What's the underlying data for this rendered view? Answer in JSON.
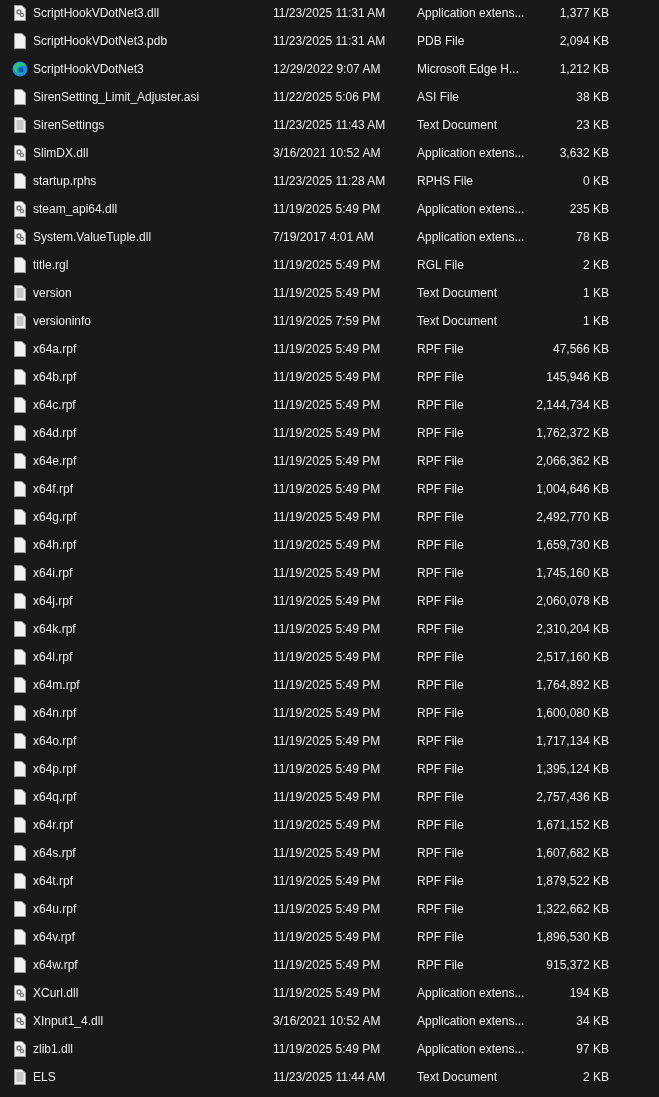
{
  "files": [
    {
      "kind": "dll",
      "name": "ScriptHookVDotNet3.dll",
      "date": "11/23/2025 11:31 AM",
      "type": "Application extens...",
      "size": "1,377 KB"
    },
    {
      "kind": "file",
      "name": "ScriptHookVDotNet3.pdb",
      "date": "11/23/2025 11:31 AM",
      "type": "PDB File",
      "size": "2,094 KB"
    },
    {
      "kind": "edge",
      "name": "ScriptHookVDotNet3",
      "date": "12/29/2022 9:07 AM",
      "type": "Microsoft Edge H...",
      "size": "1,212 KB"
    },
    {
      "kind": "file",
      "name": "SirenSetting_Limit_Adjuster.asi",
      "date": "11/22/2025 5:06 PM",
      "type": "ASI File",
      "size": "38 KB"
    },
    {
      "kind": "text",
      "name": "SirenSettings",
      "date": "11/23/2025 11:43 AM",
      "type": "Text Document",
      "size": "23 KB"
    },
    {
      "kind": "dll",
      "name": "SlimDX.dll",
      "date": "3/16/2021 10:52 AM",
      "type": "Application extens...",
      "size": "3,632 KB"
    },
    {
      "kind": "file",
      "name": "startup.rphs",
      "date": "11/23/2025 11:28 AM",
      "type": "RPHS File",
      "size": "0 KB"
    },
    {
      "kind": "dll",
      "name": "steam_api64.dll",
      "date": "11/19/2025 5:49 PM",
      "type": "Application extens...",
      "size": "235 KB"
    },
    {
      "kind": "dll",
      "name": "System.ValueTuple.dll",
      "date": "7/19/2017 4:01 AM",
      "type": "Application extens...",
      "size": "78 KB"
    },
    {
      "kind": "file",
      "name": "title.rgl",
      "date": "11/19/2025 5:49 PM",
      "type": "RGL File",
      "size": "2 KB"
    },
    {
      "kind": "text",
      "name": "version",
      "date": "11/19/2025 5:49 PM",
      "type": "Text Document",
      "size": "1 KB"
    },
    {
      "kind": "text",
      "name": "versioninfo",
      "date": "11/19/2025 7:59 PM",
      "type": "Text Document",
      "size": "1 KB"
    },
    {
      "kind": "file",
      "name": "x64a.rpf",
      "date": "11/19/2025 5:49 PM",
      "type": "RPF File",
      "size": "47,566 KB"
    },
    {
      "kind": "file",
      "name": "x64b.rpf",
      "date": "11/19/2025 5:49 PM",
      "type": "RPF File",
      "size": "145,946 KB"
    },
    {
      "kind": "file",
      "name": "x64c.rpf",
      "date": "11/19/2025 5:49 PM",
      "type": "RPF File",
      "size": "2,144,734 KB"
    },
    {
      "kind": "file",
      "name": "x64d.rpf",
      "date": "11/19/2025 5:49 PM",
      "type": "RPF File",
      "size": "1,762,372 KB"
    },
    {
      "kind": "file",
      "name": "x64e.rpf",
      "date": "11/19/2025 5:49 PM",
      "type": "RPF File",
      "size": "2,066,362 KB"
    },
    {
      "kind": "file",
      "name": "x64f.rpf",
      "date": "11/19/2025 5:49 PM",
      "type": "RPF File",
      "size": "1,004,646 KB"
    },
    {
      "kind": "file",
      "name": "x64g.rpf",
      "date": "11/19/2025 5:49 PM",
      "type": "RPF File",
      "size": "2,492,770 KB"
    },
    {
      "kind": "file",
      "name": "x64h.rpf",
      "date": "11/19/2025 5:49 PM",
      "type": "RPF File",
      "size": "1,659,730 KB"
    },
    {
      "kind": "file",
      "name": "x64i.rpf",
      "date": "11/19/2025 5:49 PM",
      "type": "RPF File",
      "size": "1,745,160 KB"
    },
    {
      "kind": "file",
      "name": "x64j.rpf",
      "date": "11/19/2025 5:49 PM",
      "type": "RPF File",
      "size": "2,060,078 KB"
    },
    {
      "kind": "file",
      "name": "x64k.rpf",
      "date": "11/19/2025 5:49 PM",
      "type": "RPF File",
      "size": "2,310,204 KB"
    },
    {
      "kind": "file",
      "name": "x64l.rpf",
      "date": "11/19/2025 5:49 PM",
      "type": "RPF File",
      "size": "2,517,160 KB"
    },
    {
      "kind": "file",
      "name": "x64m.rpf",
      "date": "11/19/2025 5:49 PM",
      "type": "RPF File",
      "size": "1,764,892 KB"
    },
    {
      "kind": "file",
      "name": "x64n.rpf",
      "date": "11/19/2025 5:49 PM",
      "type": "RPF File",
      "size": "1,600,080 KB"
    },
    {
      "kind": "file",
      "name": "x64o.rpf",
      "date": "11/19/2025 5:49 PM",
      "type": "RPF File",
      "size": "1,717,134 KB"
    },
    {
      "kind": "file",
      "name": "x64p.rpf",
      "date": "11/19/2025 5:49 PM",
      "type": "RPF File",
      "size": "1,395,124 KB"
    },
    {
      "kind": "file",
      "name": "x64q.rpf",
      "date": "11/19/2025 5:49 PM",
      "type": "RPF File",
      "size": "2,757,436 KB"
    },
    {
      "kind": "file",
      "name": "x64r.rpf",
      "date": "11/19/2025 5:49 PM",
      "type": "RPF File",
      "size": "1,671,152 KB"
    },
    {
      "kind": "file",
      "name": "x64s.rpf",
      "date": "11/19/2025 5:49 PM",
      "type": "RPF File",
      "size": "1,607,682 KB"
    },
    {
      "kind": "file",
      "name": "x64t.rpf",
      "date": "11/19/2025 5:49 PM",
      "type": "RPF File",
      "size": "1,879,522 KB"
    },
    {
      "kind": "file",
      "name": "x64u.rpf",
      "date": "11/19/2025 5:49 PM",
      "type": "RPF File",
      "size": "1,322,662 KB"
    },
    {
      "kind": "file",
      "name": "x64v.rpf",
      "date": "11/19/2025 5:49 PM",
      "type": "RPF File",
      "size": "1,896,530 KB"
    },
    {
      "kind": "file",
      "name": "x64w.rpf",
      "date": "11/19/2025 5:49 PM",
      "type": "RPF File",
      "size": "915,372 KB"
    },
    {
      "kind": "dll",
      "name": "XCurl.dll",
      "date": "11/19/2025 5:49 PM",
      "type": "Application extens...",
      "size": "194 KB"
    },
    {
      "kind": "dll",
      "name": "XInput1_4.dll",
      "date": "3/16/2021 10:52 AM",
      "type": "Application extens...",
      "size": "34 KB"
    },
    {
      "kind": "dll",
      "name": "zlib1.dll",
      "date": "11/19/2025 5:49 PM",
      "type": "Application extens...",
      "size": "97 KB"
    },
    {
      "kind": "text",
      "name": "ELS",
      "date": "11/23/2025 11:44 AM",
      "type": "Text Document",
      "size": "2 KB"
    }
  ]
}
